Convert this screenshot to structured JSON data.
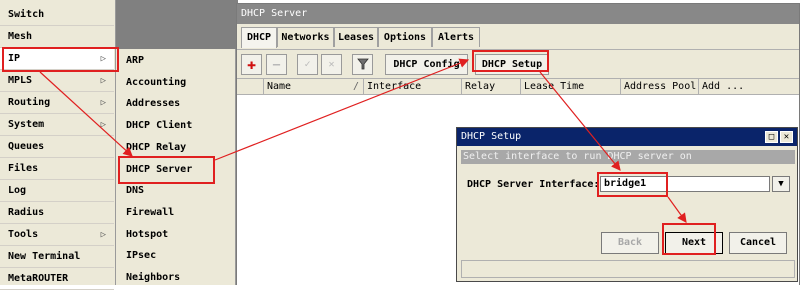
{
  "main_menu": {
    "items": [
      {
        "label": "Switch",
        "submenu": false
      },
      {
        "label": "Mesh",
        "submenu": false
      },
      {
        "label": "IP",
        "submenu": true
      },
      {
        "label": "MPLS",
        "submenu": true
      },
      {
        "label": "Routing",
        "submenu": true
      },
      {
        "label": "System",
        "submenu": true
      },
      {
        "label": "Queues",
        "submenu": false
      },
      {
        "label": "Files",
        "submenu": false
      },
      {
        "label": "Log",
        "submenu": false
      },
      {
        "label": "Radius",
        "submenu": false
      },
      {
        "label": "Tools",
        "submenu": true
      },
      {
        "label": "New Terminal",
        "submenu": false
      },
      {
        "label": "MetaROUTER",
        "submenu": false
      }
    ],
    "arrow_glyph": "▷"
  },
  "ip_submenu": {
    "items": [
      "ARP",
      "Accounting",
      "Addresses",
      "DHCP Client",
      "DHCP Relay",
      "DHCP Server",
      "DNS",
      "Firewall",
      "Hotspot",
      "IPsec",
      "Neighbors"
    ]
  },
  "dhcp_window": {
    "title": "DHCP Server",
    "tabs": [
      "DHCP",
      "Networks",
      "Leases",
      "Options",
      "Alerts"
    ],
    "toolbar": {
      "add_icon": "plus-icon",
      "remove_icon": "minus-icon",
      "enable_icon": "check-icon",
      "disable_icon": "cross-icon",
      "filter_icon": "filter-icon",
      "config_label": "DHCP Config",
      "setup_label": "DHCP Setup"
    },
    "columns": [
      "Name",
      "Interface",
      "Relay",
      "Lease Time",
      "Address Pool",
      "Add ..."
    ],
    "sort_glyph": "/"
  },
  "setup_dialog": {
    "title": "DHCP Setup",
    "hint": "Select interface to run DHCP server on",
    "interface_label": "DHCP Server Interface:",
    "interface_value": "bridge1",
    "back_label": "Back",
    "next_label": "Next",
    "cancel_label": "Cancel",
    "maximize_icon": "maximize-icon",
    "close_icon": "close-icon"
  },
  "colors": {
    "highlight": "#e02020",
    "dialog_title_bg": "#0a246a",
    "window_title_bg": "#888888",
    "menu_bg": "#ece9d8"
  }
}
